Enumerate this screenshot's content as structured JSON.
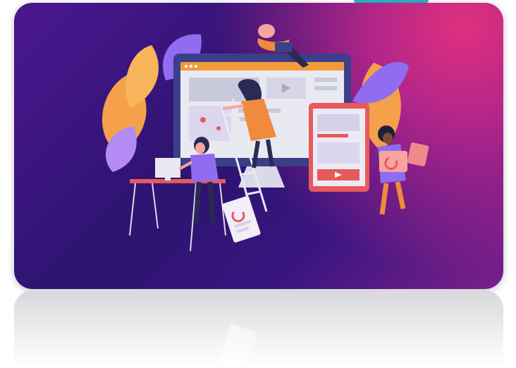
{
  "scene": {
    "description_alt": "",
    "colors": {
      "card_dark": "#2c1470",
      "card_purple": "#4b1690",
      "card_magenta": "#e0307e",
      "leaf_orange": "#f5a04a",
      "leaf_lavender": "#8f6cf0",
      "screen_bg": "#e9e9f2",
      "browser_bar": "#f59a3a",
      "person_orange": "#f08a3c",
      "tablet_red": "#e85a5a",
      "teal_accent": "#2ab5c9"
    },
    "icons": [
      "play-icon",
      "map-icon",
      "chart-card-icon",
      "monitor-icon",
      "tablet-icon",
      "ladder-icon",
      "desk-icon"
    ]
  }
}
